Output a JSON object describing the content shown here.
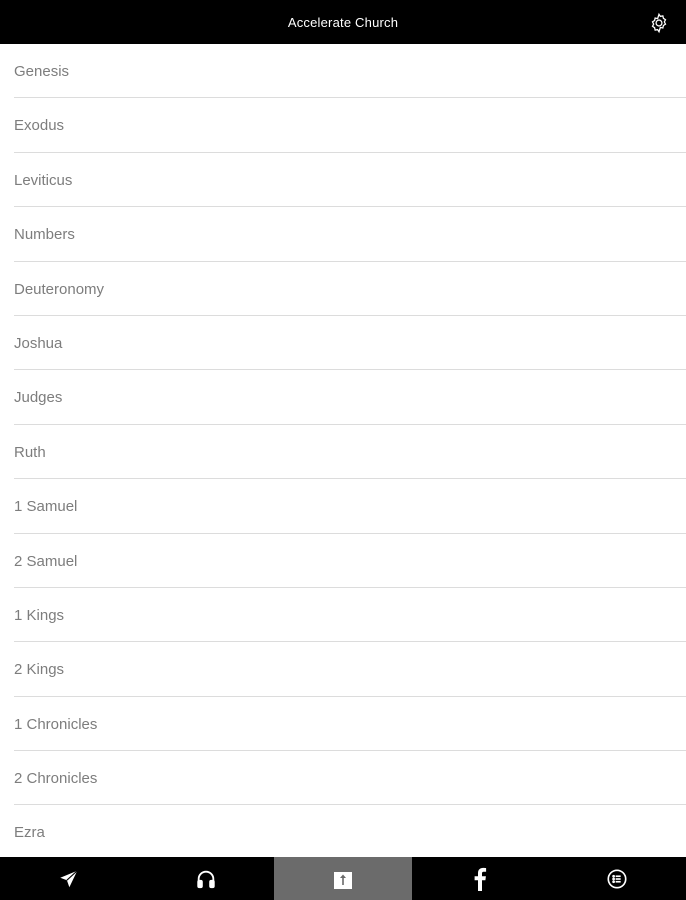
{
  "header": {
    "title": "Accelerate Church",
    "settings_icon": "gear-icon"
  },
  "books": [
    "Genesis",
    "Exodus",
    "Leviticus",
    "Numbers",
    "Deuteronomy",
    "Joshua",
    "Judges",
    "Ruth",
    "1 Samuel",
    "2 Samuel",
    "1 Kings",
    "2 Kings",
    "1 Chronicles",
    "2 Chronicles",
    "Ezra"
  ],
  "tabbar": {
    "tabs": [
      {
        "icon": "send-icon",
        "active": false
      },
      {
        "icon": "headphones-icon",
        "active": false
      },
      {
        "icon": "bible-icon",
        "active": true
      },
      {
        "icon": "facebook-icon",
        "active": false
      },
      {
        "icon": "list-circle-icon",
        "active": false
      }
    ]
  },
  "colors": {
    "bar_background": "#000000",
    "active_tab": "#6b6b6b",
    "list_text": "#7d7d7d",
    "divider": "#dcdcdc"
  }
}
